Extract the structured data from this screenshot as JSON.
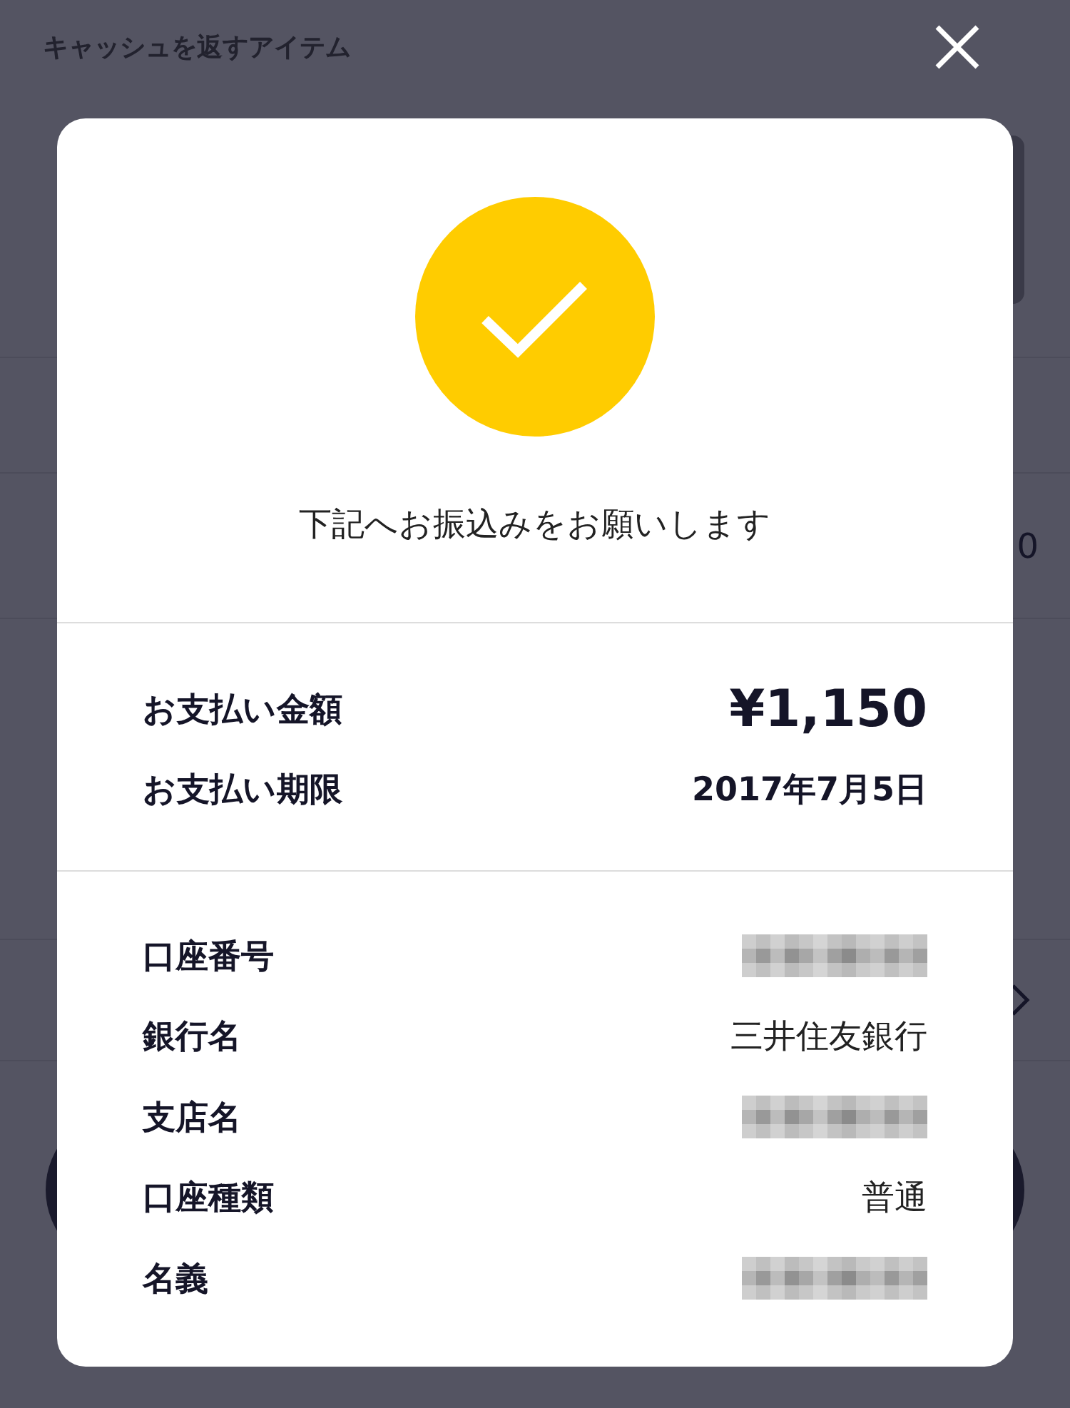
{
  "background": {
    "title": "キャッシュを返すアイテム",
    "edge_text": "0"
  },
  "modal": {
    "message": "下記へお振込みをお願いします",
    "summary": [
      {
        "label": "お支払い金額",
        "value": "¥1,150",
        "kind": "amount"
      },
      {
        "label": "お支払い期限",
        "value": "2017年7月5日",
        "kind": "date"
      }
    ],
    "details": [
      {
        "label": "口座番号",
        "redacted": true
      },
      {
        "label": "銀行名",
        "value": "三井住友銀行",
        "redacted": false
      },
      {
        "label": "支店名",
        "redacted": true
      },
      {
        "label": "口座種類",
        "value": "普通",
        "redacted": false
      },
      {
        "label": "名義",
        "redacted": true
      }
    ]
  }
}
